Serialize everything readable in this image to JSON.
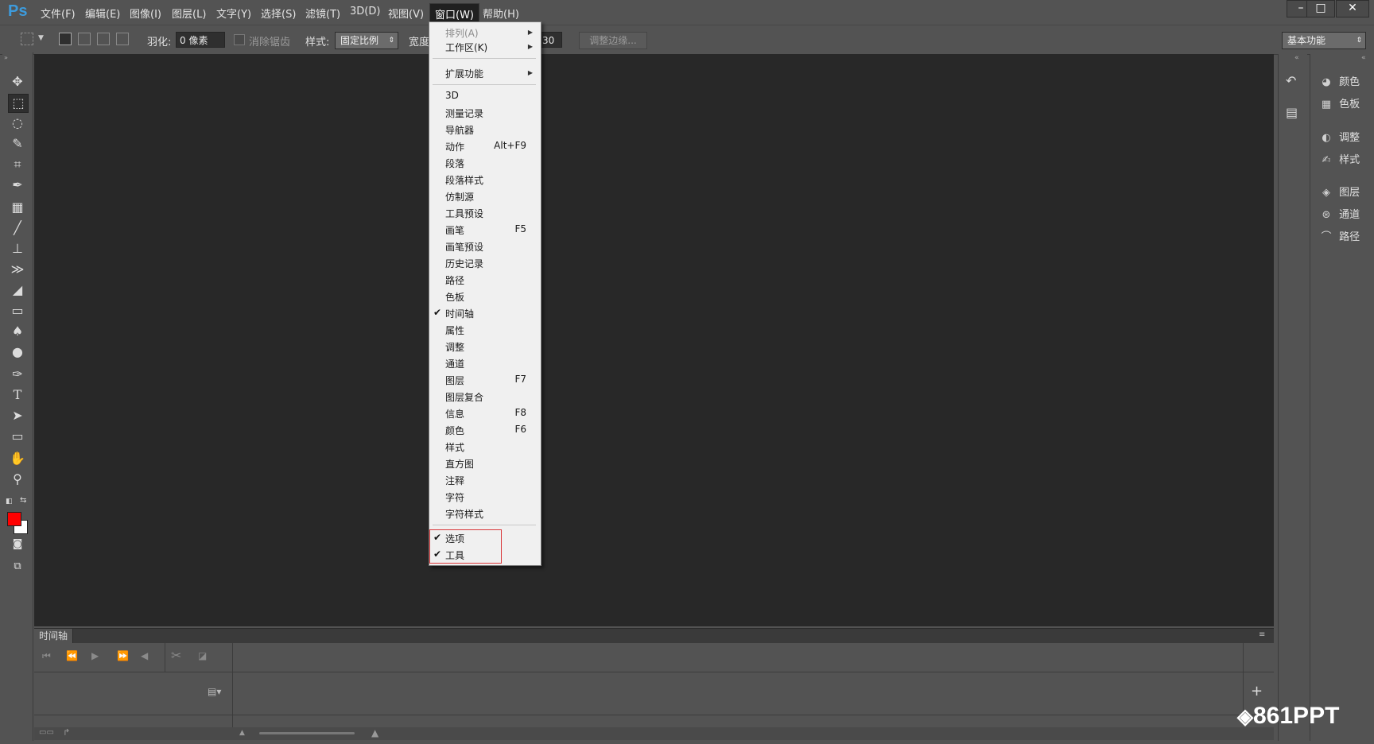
{
  "app": {
    "logo": "Ps"
  },
  "menubar": {
    "items": [
      "文件(F)",
      "编辑(E)",
      "图像(I)",
      "图层(L)",
      "文字(Y)",
      "选择(S)",
      "滤镜(T)",
      "3D(D)",
      "视图(V)",
      "窗口(W)",
      "帮助(H)"
    ],
    "active": "窗口(W)"
  },
  "window_controls": {
    "minimize": "–",
    "maximize": "□",
    "close": "✕"
  },
  "options": {
    "feather_label": "羽化:",
    "feather_value": "0 像素",
    "antialias_label": "消除锯齿",
    "style_label": "样式:",
    "style_value": "固定比例",
    "width_label": "宽度",
    "height_value": "30",
    "refine_edge": "调整边缘...",
    "workspace": "基本功能"
  },
  "window_menu": {
    "items": [
      {
        "label": "排列(A)",
        "disabled": true,
        "submenu": true
      },
      {
        "label": "工作区(K)",
        "submenu": true
      },
      {
        "label": "扩展功能",
        "submenu": true
      },
      {
        "label": "3D"
      },
      {
        "label": "测量记录"
      },
      {
        "label": "导航器"
      },
      {
        "label": "动作",
        "shortcut": "Alt+F9"
      },
      {
        "label": "段落"
      },
      {
        "label": "段落样式"
      },
      {
        "label": "仿制源"
      },
      {
        "label": "工具预设"
      },
      {
        "label": "画笔",
        "shortcut": "F5"
      },
      {
        "label": "画笔预设"
      },
      {
        "label": "历史记录"
      },
      {
        "label": "路径"
      },
      {
        "label": "色板"
      },
      {
        "label": "时间轴",
        "checked": true
      },
      {
        "label": "属性"
      },
      {
        "label": "调整"
      },
      {
        "label": "通道"
      },
      {
        "label": "图层",
        "shortcut": "F7"
      },
      {
        "label": "图层复合"
      },
      {
        "label": "信息",
        "shortcut": "F8"
      },
      {
        "label": "颜色",
        "shortcut": "F6"
      },
      {
        "label": "样式"
      },
      {
        "label": "直方图"
      },
      {
        "label": "注释"
      },
      {
        "label": "字符"
      },
      {
        "label": "字符样式"
      },
      {
        "label": "选项",
        "checked": true
      },
      {
        "label": "工具",
        "checked": true
      }
    ]
  },
  "panels": {
    "items": [
      {
        "label": "颜色",
        "icon": "color-palette-icon"
      },
      {
        "label": "色板",
        "icon": "swatches-icon"
      },
      {
        "label": "调整",
        "icon": "adjustments-icon"
      },
      {
        "label": "样式",
        "icon": "styles-icon"
      },
      {
        "label": "图层",
        "icon": "layers-icon"
      },
      {
        "label": "通道",
        "icon": "channels-icon"
      },
      {
        "label": "路径",
        "icon": "paths-icon"
      }
    ]
  },
  "timeline": {
    "tab": "时间轴",
    "add": "+"
  },
  "watermark": "861PPT",
  "colors": {
    "foreground": "#ff0000",
    "background": "#ffffff",
    "highlight_box": "#d9383a",
    "canvas": "#282828"
  }
}
